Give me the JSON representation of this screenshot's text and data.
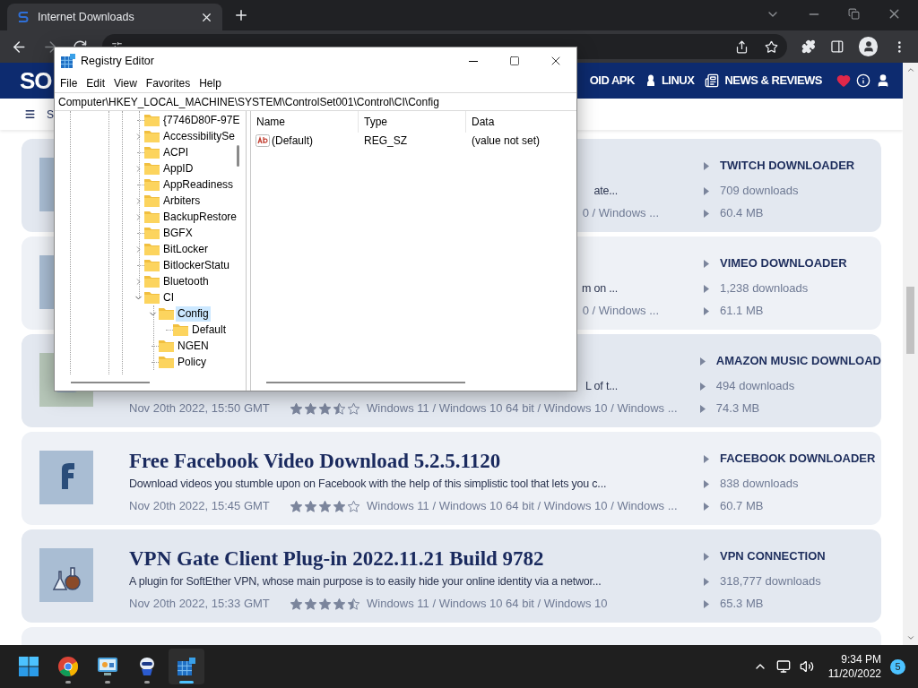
{
  "browser": {
    "tab_title": "Internet Downloads"
  },
  "site": {
    "logo": "SO",
    "nav": [
      {
        "label": "OID APK"
      },
      {
        "label": "LINUX"
      },
      {
        "label": "NEWS & REVIEWS"
      }
    ],
    "subnav": "S"
  },
  "cards": [
    {
      "kind": "covered",
      "description": "ate...",
      "os": "0 / Windows ...",
      "category": "TWITCH DOWNLOADER",
      "downloads": "709 downloads",
      "size": "60.4 MB"
    },
    {
      "kind": "covered",
      "description": "m on ...",
      "os": "0 / Windows ...",
      "category": "VIMEO DOWNLOADER",
      "downloads": "1,238 downloads",
      "size": "61.1 MB"
    },
    {
      "kind": "partly_covered",
      "description": "L of t...",
      "date": "Nov 20th 2022, 15:50 GMT",
      "stars": 3.5,
      "os": "Windows 11 / Windows 10 64 bit / Windows 10 / Windows ...",
      "category": "AMAZON MUSIC DOWNLOAD",
      "downloads": "494 downloads",
      "size": "74.3 MB"
    },
    {
      "kind": "full",
      "title": "Free Facebook Video Download 5.2.5.1120",
      "description": "Download videos you stumble upon on Facebook with the help of this simplistic tool that lets you c...",
      "date": "Nov 20th 2022, 15:45 GMT",
      "stars": 4,
      "os": "Windows 11 / Windows 10 64 bit / Windows 10 / Windows ...",
      "category": "FACEBOOK DOWNLOADER",
      "downloads": "838 downloads",
      "size": "60.7 MB"
    },
    {
      "kind": "full",
      "title": "VPN Gate Client Plug-in 2022.11.21 Build 9782",
      "description": "A plugin for SoftEther VPN, whose main purpose is to easily hide your online identity via a networ...",
      "date": "Nov 20th 2022, 15:33 GMT",
      "stars": 4.5,
      "os": "Windows 11 / Windows 10 64 bit / Windows 10",
      "category": "VPN CONNECTION",
      "downloads": "318,777 downloads",
      "size": "65.3 MB"
    }
  ],
  "registry_editor": {
    "title": "Registry Editor",
    "menu": [
      "File",
      "Edit",
      "View",
      "Favorites",
      "Help"
    ],
    "address": "Computer\\HKEY_LOCAL_MACHINE\\SYSTEM\\ControlSet001\\Control\\CI\\Config",
    "tree": [
      {
        "label": "{7746D80F-97E",
        "expandable": false,
        "selected": false
      },
      {
        "label": "AccessibilitySe",
        "expandable": true,
        "expanded": false,
        "selected": false
      },
      {
        "label": "ACPI",
        "expandable": false,
        "selected": false
      },
      {
        "label": "AppID",
        "expandable": true,
        "expanded": false,
        "selected": false
      },
      {
        "label": "AppReadiness",
        "expandable": false,
        "selected": false
      },
      {
        "label": "Arbiters",
        "expandable": true,
        "expanded": false,
        "selected": false
      },
      {
        "label": "BackupRestore",
        "expandable": true,
        "expanded": false,
        "selected": false
      },
      {
        "label": "BGFX",
        "expandable": false,
        "selected": false
      },
      {
        "label": "BitLocker",
        "expandable": true,
        "expanded": false,
        "selected": false
      },
      {
        "label": "BitlockerStatu",
        "expandable": false,
        "selected": false
      },
      {
        "label": "Bluetooth",
        "expandable": true,
        "expanded": false,
        "selected": false
      },
      {
        "label": "CI",
        "expandable": true,
        "expanded": true,
        "selected": false,
        "children": [
          {
            "label": "Config",
            "expandable": true,
            "expanded": true,
            "selected": true,
            "children": [
              {
                "label": "Default",
                "expandable": false,
                "selected": false
              }
            ]
          },
          {
            "label": "NGEN",
            "expandable": false,
            "selected": false
          },
          {
            "label": "Policy",
            "expandable": false,
            "selected": false
          }
        ]
      }
    ],
    "columns": [
      "Name",
      "Type",
      "Data"
    ],
    "rows": [
      {
        "name": "(Default)",
        "type": "REG_SZ",
        "data": "(value not set)"
      }
    ]
  },
  "taskbar": {
    "apps": [
      {
        "selected": false
      },
      {
        "selected": false
      },
      {
        "selected": false
      },
      {
        "selected": true
      }
    ],
    "time": "9:34 PM",
    "date": "11/20/2022",
    "notifications": "5"
  }
}
